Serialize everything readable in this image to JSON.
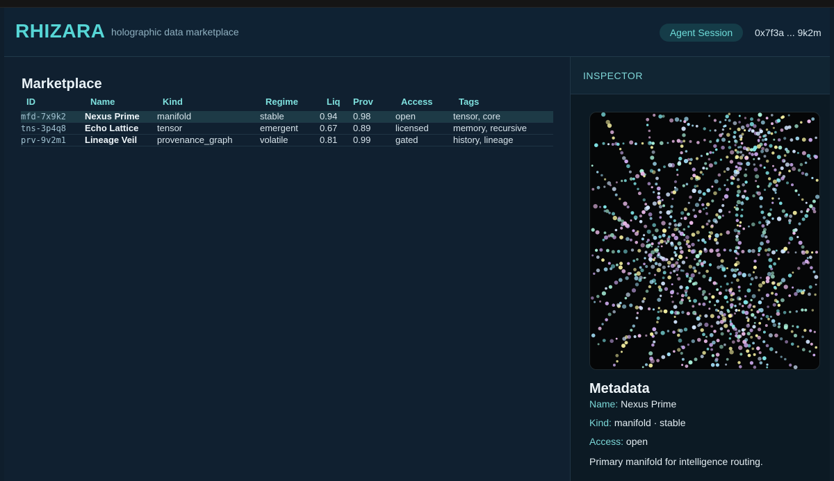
{
  "header": {
    "logo": "RHIZARA",
    "tagline": "holographic data marketplace",
    "session_button": "Agent Session",
    "wallet": "0x7f3a ... 9k2m"
  },
  "marketplace": {
    "title": "Marketplace",
    "columns": [
      "ID",
      "Name",
      "Kind",
      "Regime",
      "Liq",
      "Prov",
      "Access",
      "Tags"
    ],
    "rows": [
      {
        "id": "mfd-7x9k2",
        "name": "Nexus Prime",
        "kind": "manifold",
        "regime": "stable",
        "liq": "0.94",
        "prov": "0.98",
        "access": "open",
        "tags": "tensor, core"
      },
      {
        "id": "tns-3p4q8",
        "name": "Echo Lattice",
        "kind": "tensor",
        "regime": "emergent",
        "liq": "0.67",
        "prov": "0.89",
        "access": "licensed",
        "tags": "memory, recursive"
      },
      {
        "id": "prv-9v2m1",
        "name": "Lineage Veil",
        "kind": "provenance_graph",
        "regime": "volatile",
        "liq": "0.81",
        "prov": "0.99",
        "access": "gated",
        "tags": "history, lineage"
      }
    ]
  },
  "inspector": {
    "title": "INSPECTOR",
    "metadata_title": "Metadata",
    "name_key": "Name:",
    "name_value": "Nexus Prime",
    "kind_key": "Kind:",
    "kind_value": "manifold · stable",
    "access_key": "Access:",
    "access_value": "open",
    "description": "Primary manifold for intelligence routing."
  },
  "colors": {
    "accent": "#56d6d6",
    "background": "#0f1e2c",
    "selected_row": "#1d3a46"
  }
}
